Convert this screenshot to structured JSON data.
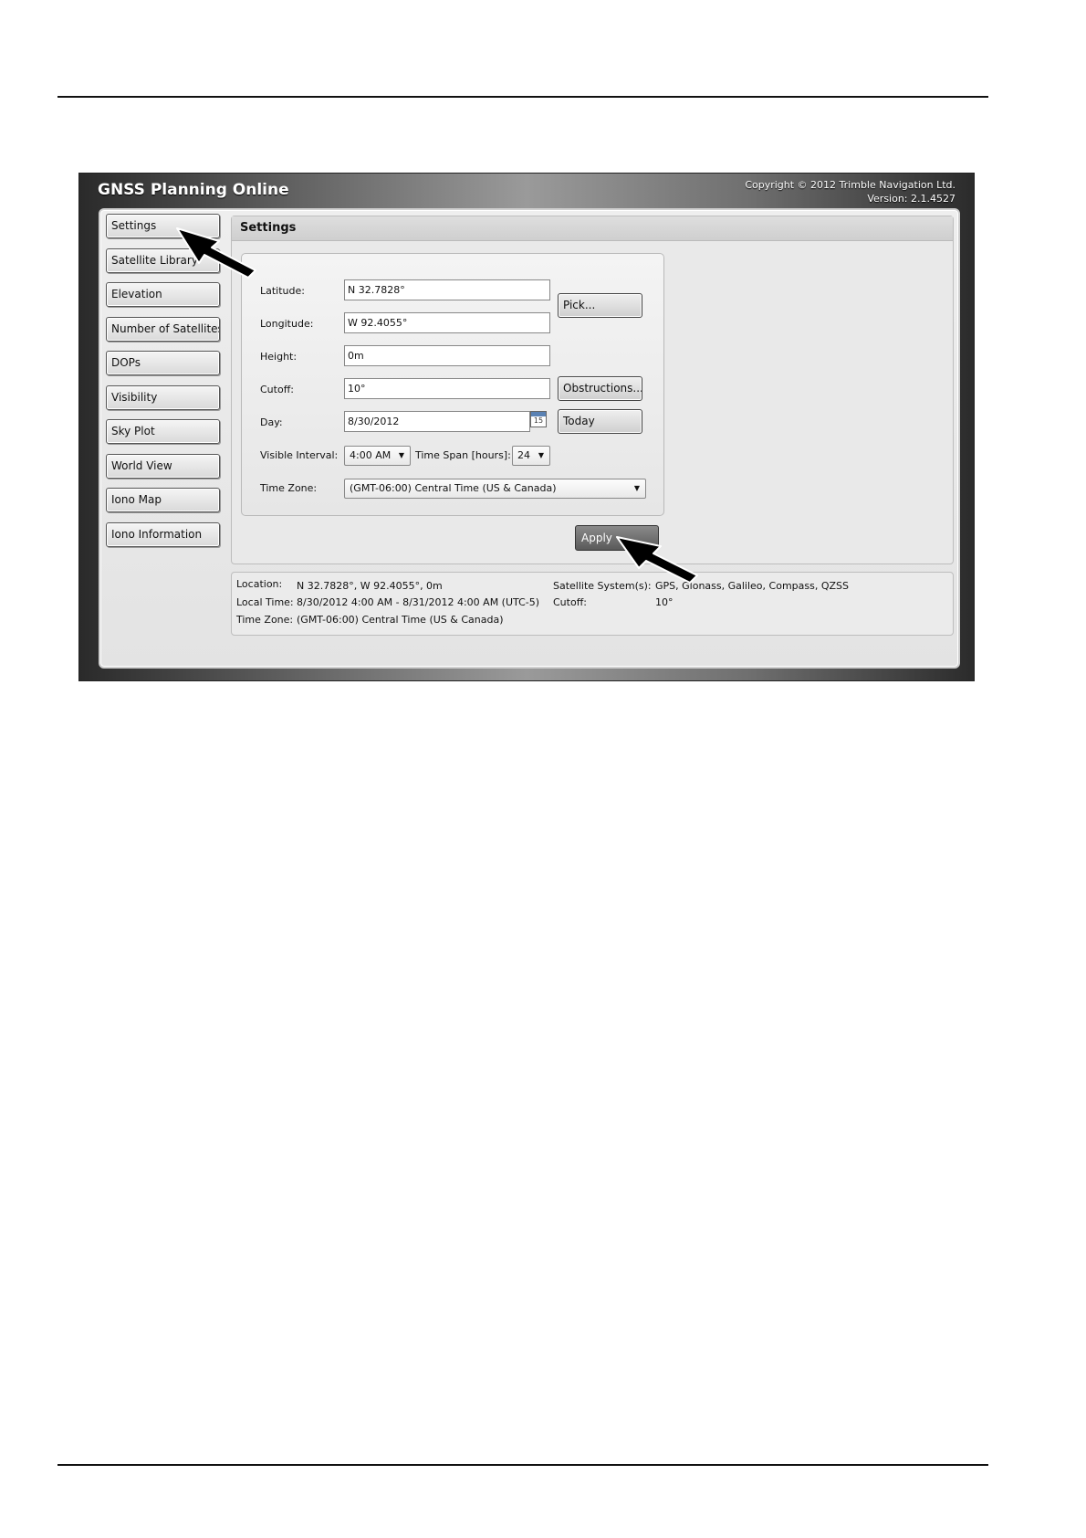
{
  "app": {
    "title": "GNSS Planning Online",
    "copyright": "Copyright ©  2012 Trimble Navigation Ltd.",
    "version": "Version: 2.1.4527"
  },
  "sidebar": {
    "items": [
      {
        "label": "Settings"
      },
      {
        "label": "Satellite Library"
      },
      {
        "label": "Elevation"
      },
      {
        "label": "Number of Satellites"
      },
      {
        "label": "DOPs"
      },
      {
        "label": "Visibility"
      },
      {
        "label": "Sky Plot"
      },
      {
        "label": "World View"
      },
      {
        "label": "Iono Map"
      },
      {
        "label": "Iono Information"
      }
    ]
  },
  "settings": {
    "title": "Settings",
    "latitude_label": "Latitude:",
    "latitude_value": "N 32.7828°",
    "longitude_label": "Longitude:",
    "longitude_value": "W 92.4055°",
    "height_label": "Height:",
    "height_value": "0m",
    "cutoff_label": "Cutoff:",
    "cutoff_value": "10°",
    "day_label": "Day:",
    "day_value": "8/30/2012",
    "calendar_day": "15",
    "visible_interval_label": "Visible Interval:",
    "visible_interval_value": "4:00 AM",
    "time_span_label": "Time Span [hours]:",
    "time_span_value": "24",
    "time_zone_label": "Time Zone:",
    "time_zone_value": "(GMT-06:00) Central Time (US & Canada)",
    "pick_label": "Pick...",
    "obstructions_label": "Obstructions...",
    "today_label": "Today",
    "apply_label": "Apply"
  },
  "summary": {
    "location_label": "Location:",
    "location_value": "N 32.7828°, W 92.4055°, 0m",
    "local_time_label": "Local Time:",
    "local_time_value": "8/30/2012 4:00 AM - 8/31/2012 4:00 AM (UTC-5)",
    "time_zone_label": "Time Zone:",
    "time_zone_value": "(GMT-06:00) Central Time (US & Canada)",
    "satellite_systems_label": "Satellite System(s):",
    "satellite_systems_value": "GPS, Glonass, Galileo, Compass, QZSS",
    "cutoff_label": "Cutoff:",
    "cutoff_value": "10°"
  },
  "icons": {
    "calendar": "calendar-icon",
    "dropdown": "chevron-down-icon",
    "pointer": "arrow-pointer-icon"
  }
}
